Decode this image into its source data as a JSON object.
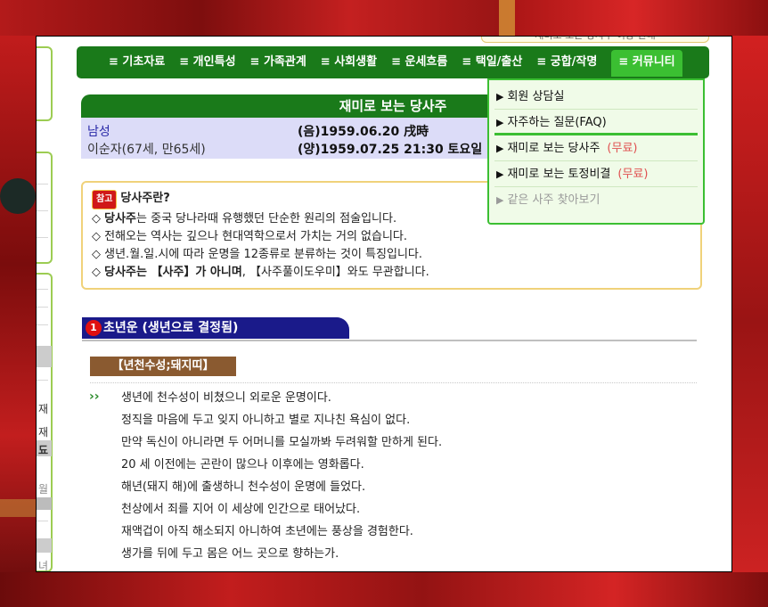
{
  "top_info": "재미로 보는 당사주 이용 안내",
  "nav": {
    "items": [
      "≡ 기초자료",
      "≡ 개인특성",
      "≡ 가족관계",
      "≡ 사회생활",
      "≡ 운세흐름",
      "≡ 택일/출산",
      "≡ 궁합/작명",
      "≡ 커뮤니티"
    ],
    "active_index": 7
  },
  "dropdown": {
    "items": [
      {
        "label": "회원 상담실",
        "free": ""
      },
      {
        "label": "자주하는 질문(FAQ)",
        "free": ""
      },
      {
        "label": "재미로 보는 당사주",
        "free": "(무료)"
      },
      {
        "label": "재미로 보는 토정비결",
        "free": "(무료)"
      },
      {
        "label": "같은 사주 찾아보기",
        "free": ""
      }
    ]
  },
  "title": "재미로 보는 당사주",
  "person": {
    "gender": "남성",
    "name": "이순자(67세, 만65세)",
    "lunar": "(음)1959.06.20 戌時",
    "solar": "(양)1959.07.25 21:30 토요일"
  },
  "note": {
    "tag": "참고",
    "heading": "당사주란?",
    "lines": [
      {
        "prefix": "◇ ",
        "bold": "당사주",
        "text": "는 중국 당나라때 유행했던 단순한 원리의 점술입니다."
      },
      {
        "prefix": "◇ ",
        "bold": "",
        "text": "전해오는 역사는 깊으나 현대역학으로서 가치는 거의 없습니다."
      },
      {
        "prefix": "◇ ",
        "bold": "",
        "text": "생년.월.일.시에 따라 운명을 12종류로 분류하는 것이 특징입니다."
      },
      {
        "prefix": "◇ ",
        "bold": "당사주는 【사주】가 아니며",
        "text": ", 【사주풀이도우미】와도 무관합니다."
      }
    ]
  },
  "section": {
    "num": "1",
    "title": "초년운 (생년으로 결정됨)"
  },
  "sub_title": "【년천수성;돼지띠】",
  "fortune_lines": [
    "생년에 천수성이 비쳤으니 외로운 운명이다.",
    "정직을 마음에 두고 잊지 아니하고 별로 지나친 욕심이 없다.",
    "만약 독신이 아니라면 두 어머니를 모실까봐 두려워할 만하게 된다.",
    "20 세 이전에는 곤란이 많으나 이후에는 영화롭다.",
    "해년(돼지 해)에 출생하니 천수성이 운명에 들었다.",
    "천상에서 죄를 지어 이 세상에 인간으로 태어났다.",
    "재액겁이 아직 해소되지 아니하여 초년에는 풍상을 경험한다.",
    "생가를 뒤에 두고 몸은 어느 곳으로 향하는가."
  ],
  "sidebar_chars": [
    "재",
    "재",
    "됴",
    "월",
    "녀"
  ]
}
